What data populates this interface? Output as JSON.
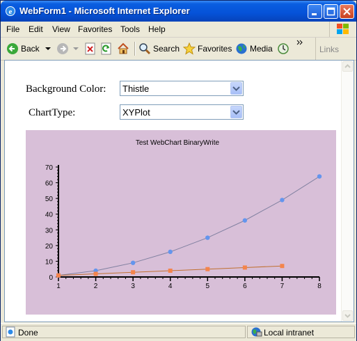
{
  "window": {
    "title": "WebForm1 - Microsoft Internet Explorer"
  },
  "menu": {
    "items": [
      "File",
      "Edit",
      "View",
      "Favorites",
      "Tools",
      "Help"
    ]
  },
  "toolbar": {
    "back": "Back",
    "search": "Search",
    "favorites": "Favorites",
    "media": "Media",
    "links": "Links"
  },
  "form": {
    "background_label": "Background Color:",
    "background_value": "Thistle",
    "charttype_label": "ChartType:",
    "charttype_value": "XYPlot"
  },
  "colors": {
    "chart_bg": "#d8bfd8",
    "series1": "#6495ed",
    "series2": "#f4844c",
    "series1_line": "#8080a0",
    "series2_line": "#c07030"
  },
  "chart_data": {
    "type": "scatter",
    "title": "Test WebChart BinaryWrite",
    "xlim": [
      1,
      8
    ],
    "ylim": [
      0,
      70
    ],
    "xticks": [
      1,
      2,
      3,
      4,
      5,
      6,
      7,
      8
    ],
    "yticks": [
      0,
      10,
      20,
      30,
      40,
      50,
      60,
      70
    ],
    "series": [
      {
        "marker": "circle",
        "x": [
          1,
          2,
          3,
          4,
          5,
          6,
          7,
          8
        ],
        "y": [
          1,
          4,
          9,
          16,
          25,
          36,
          49,
          64
        ]
      },
      {
        "marker": "square",
        "x": [
          1,
          2,
          3,
          4,
          5,
          6,
          7
        ],
        "y": [
          1,
          2,
          3,
          4,
          5,
          6,
          7
        ]
      }
    ]
  },
  "status": {
    "left": "Done",
    "zone": "Local intranet"
  }
}
